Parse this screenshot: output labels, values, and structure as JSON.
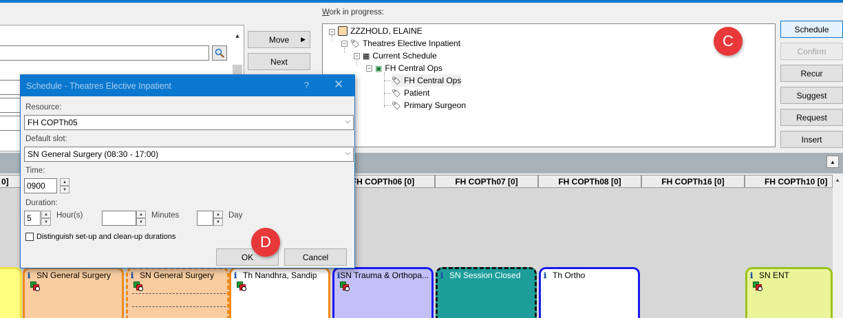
{
  "work_in_progress": {
    "label_prefix": "W",
    "label_rest": "ork in progress:",
    "tree": {
      "patient": "ZZZHOLD, ELAINE",
      "request": "Theatres Elective Inpatient",
      "schedule": "Current Schedule",
      "location": "FH Central Ops",
      "children": [
        "FH Central Ops",
        "Patient",
        "Primary Surgeon"
      ]
    }
  },
  "actions": {
    "move": "Move",
    "next": "Next",
    "schedule": "Schedule",
    "confirm": "Confirm",
    "recur": "Recur",
    "suggest": "Suggest",
    "request": "Request",
    "insert": "Insert"
  },
  "callouts": {
    "c": "C",
    "d": "D"
  },
  "dialog": {
    "title": "Schedule - Theatres Elective Inpatient",
    "help": "?",
    "close": "✕",
    "resource_label": "Resource:",
    "resource_value": "FH COPTh05",
    "slot_label": "Default slot:",
    "slot_value": "SN General Surgery (08:30 - 17:00)",
    "time_label": "Time:",
    "time_value": "0900",
    "duration_label": "Duration:",
    "hours_value": "5",
    "hours_label": "Hour(s)",
    "minutes_value": "",
    "minutes_label": "Minutes",
    "day_value": "",
    "day_label": "Day",
    "checkbox_label": "Distinguish set-up and clean-up durations",
    "checkbox_checked": false,
    "ok": "OK",
    "cancel": "Cancel"
  },
  "grid": {
    "left_partial_header": "0]",
    "columns": [
      "FH COPTh06 [0]",
      "FH COPTh07 [0]",
      "FH COPTh08 [0]",
      "FH COPTh16 [0]",
      "FH COPTh10 [0]"
    ],
    "sessions": [
      {
        "label": "SN General Surgery",
        "color": "#f9cda0",
        "border": "#f08a18"
      },
      {
        "label": "SN General Surgery",
        "color": "#f9cda0",
        "border": "#f08a18"
      },
      {
        "label": "Th Nandhra, Sandip",
        "color": "#ffffff",
        "border": "#f08a18"
      },
      {
        "label": "SN Trauma & Orthopa...",
        "color": "#c2c0f6",
        "border": "#1a1af0"
      },
      {
        "label": "SN Session Closed",
        "color": "#1e9e9a",
        "border": "#111111"
      },
      {
        "label": "Th Ortho",
        "color": "#ffffff",
        "border": "#1a1af0"
      },
      {
        "label": "SN ENT",
        "color": "#eaf59a",
        "border": "#9cc21c"
      }
    ],
    "info_icon": "info-icon",
    "session_icon": "session-status-icon"
  }
}
